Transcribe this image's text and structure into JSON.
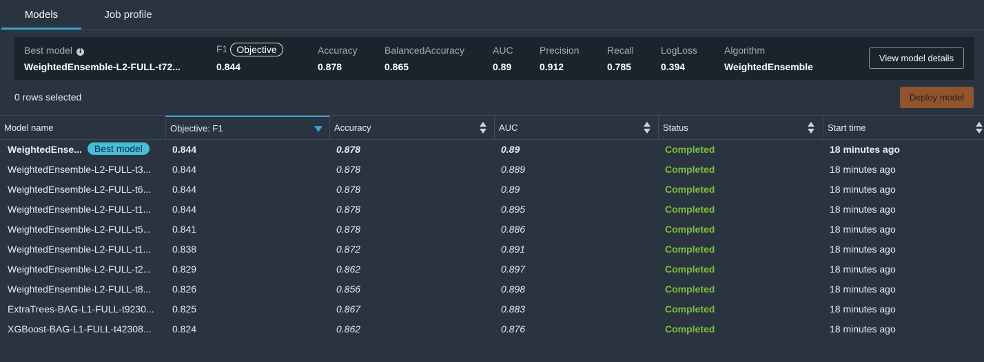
{
  "tabs": [
    {
      "label": "Models",
      "active": true
    },
    {
      "label": "Job profile",
      "active": false
    }
  ],
  "summary": {
    "best_model_label": "Best model",
    "best_model_value": "WeightedEnsemble-L2-FULL-t72...",
    "f1_label": "F1",
    "objective_pill": "Objective",
    "f1_value": "0.844",
    "accuracy_label": "Accuracy",
    "accuracy_value": "0.878",
    "balanced_label": "BalancedAccuracy",
    "balanced_value": "0.865",
    "auc_label": "AUC",
    "auc_value": "0.89",
    "precision_label": "Precision",
    "precision_value": "0.912",
    "recall_label": "Recall",
    "recall_value": "0.785",
    "logloss_label": "LogLoss",
    "logloss_value": "0.394",
    "algorithm_label": "Algorithm",
    "algorithm_value": "WeightedEnsemble",
    "view_details_label": "View model details"
  },
  "selection": {
    "rows_selected": "0 rows selected",
    "deploy_label": "Deploy model"
  },
  "table": {
    "headers": {
      "model_name": "Model name",
      "objective": "Objective: F1",
      "accuracy": "Accuracy",
      "auc": "AUC",
      "status": "Status",
      "start_time": "Start time"
    },
    "best_badge": "Best model",
    "rows": [
      {
        "name": "WeightedEnse...",
        "f1": "0.844",
        "accuracy": "0.878",
        "auc": "0.89",
        "status": "Completed",
        "start": "18 minutes ago"
      },
      {
        "name": "WeightedEnsemble-L2-FULL-t3...",
        "f1": "0.844",
        "accuracy": "0.878",
        "auc": "0.889",
        "status": "Completed",
        "start": "18 minutes ago"
      },
      {
        "name": "WeightedEnsemble-L2-FULL-t6...",
        "f1": "0.844",
        "accuracy": "0.878",
        "auc": "0.89",
        "status": "Completed",
        "start": "18 minutes ago"
      },
      {
        "name": "WeightedEnsemble-L2-FULL-t1...",
        "f1": "0.844",
        "accuracy": "0.878",
        "auc": "0.895",
        "status": "Completed",
        "start": "18 minutes ago"
      },
      {
        "name": "WeightedEnsemble-L2-FULL-t5...",
        "f1": "0.841",
        "accuracy": "0.878",
        "auc": "0.886",
        "status": "Completed",
        "start": "18 minutes ago"
      },
      {
        "name": "WeightedEnsemble-L2-FULL-t1...",
        "f1": "0.838",
        "accuracy": "0.872",
        "auc": "0.891",
        "status": "Completed",
        "start": "18 minutes ago"
      },
      {
        "name": "WeightedEnsemble-L2-FULL-t2...",
        "f1": "0.829",
        "accuracy": "0.862",
        "auc": "0.897",
        "status": "Completed",
        "start": "18 minutes ago"
      },
      {
        "name": "WeightedEnsemble-L2-FULL-t8...",
        "f1": "0.826",
        "accuracy": "0.856",
        "auc": "0.898",
        "status": "Completed",
        "start": "18 minutes ago"
      },
      {
        "name": "ExtraTrees-BAG-L1-FULL-t9230...",
        "f1": "0.825",
        "accuracy": "0.867",
        "auc": "0.883",
        "status": "Completed",
        "start": "18 minutes ago"
      },
      {
        "name": "XGBoost-BAG-L1-FULL-t42308...",
        "f1": "0.824",
        "accuracy": "0.862",
        "auc": "0.876",
        "status": "Completed",
        "start": "18 minutes ago"
      }
    ]
  },
  "colors": {
    "background": "#2a3340",
    "panel": "#1b232d",
    "accent": "#3aa3c9",
    "status_completed": "#7bc03b",
    "badge": "#44bfd9",
    "deploy_button": "#a35a2b"
  },
  "icons": {
    "info": "info-icon",
    "sort_desc": "sort-desc-icon",
    "sort_both": "sort-both-icon"
  }
}
